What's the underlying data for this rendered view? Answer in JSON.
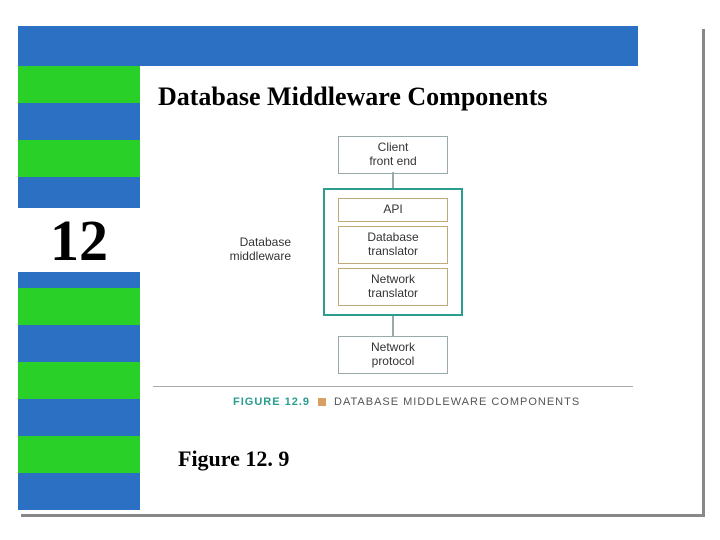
{
  "slide": {
    "title": "Database Middleware Components",
    "chapter_number": "12",
    "figure_caption": "Figure 12. 9"
  },
  "diagram": {
    "top_box": "Client\nfront end",
    "middleware_label": "Database\nmiddleware",
    "mw": {
      "api": "API",
      "db_translator": "Database\ntranslator",
      "net_translator": "Network\ntranslator"
    },
    "bottom_box": "Network\nprotocol",
    "inline_caption": {
      "label": "FIGURE 12.9",
      "title": "DATABASE MIDDLEWARE COMPONENTS"
    }
  },
  "colors": {
    "blue": "#2b70c3",
    "green": "#28d028",
    "teal": "#2a9d8f"
  }
}
